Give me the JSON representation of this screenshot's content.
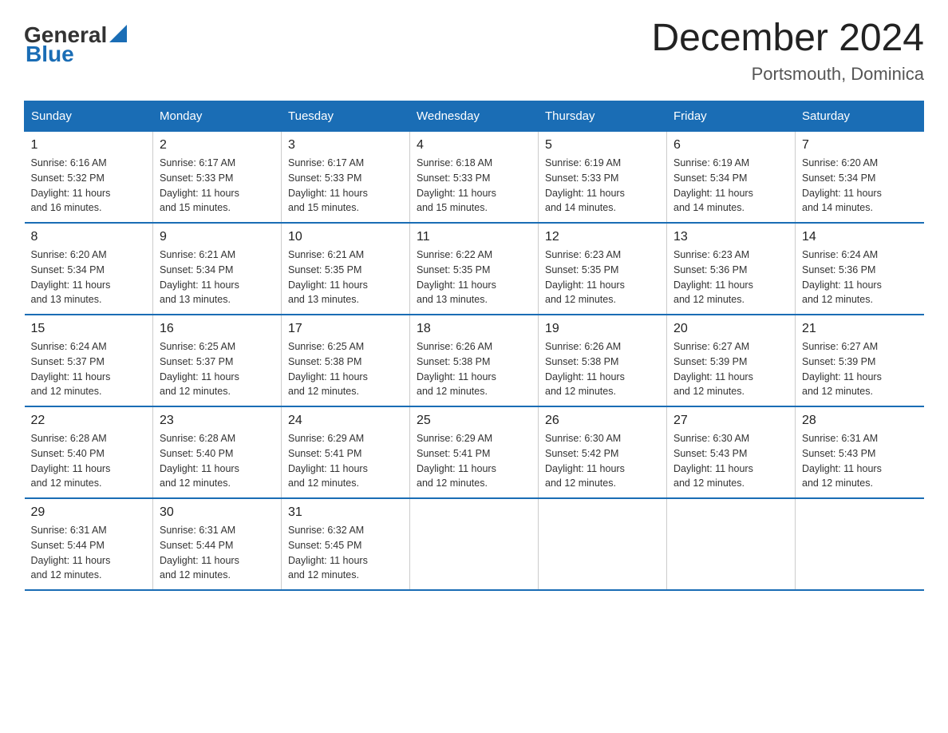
{
  "header": {
    "logo": {
      "general": "General",
      "blue": "Blue"
    },
    "title": "December 2024",
    "location": "Portsmouth, Dominica"
  },
  "calendar": {
    "weekdays": [
      "Sunday",
      "Monday",
      "Tuesday",
      "Wednesday",
      "Thursday",
      "Friday",
      "Saturday"
    ],
    "weeks": [
      [
        {
          "day": "1",
          "info": "Sunrise: 6:16 AM\nSunset: 5:32 PM\nDaylight: 11 hours\nand 16 minutes."
        },
        {
          "day": "2",
          "info": "Sunrise: 6:17 AM\nSunset: 5:33 PM\nDaylight: 11 hours\nand 15 minutes."
        },
        {
          "day": "3",
          "info": "Sunrise: 6:17 AM\nSunset: 5:33 PM\nDaylight: 11 hours\nand 15 minutes."
        },
        {
          "day": "4",
          "info": "Sunrise: 6:18 AM\nSunset: 5:33 PM\nDaylight: 11 hours\nand 15 minutes."
        },
        {
          "day": "5",
          "info": "Sunrise: 6:19 AM\nSunset: 5:33 PM\nDaylight: 11 hours\nand 14 minutes."
        },
        {
          "day": "6",
          "info": "Sunrise: 6:19 AM\nSunset: 5:34 PM\nDaylight: 11 hours\nand 14 minutes."
        },
        {
          "day": "7",
          "info": "Sunrise: 6:20 AM\nSunset: 5:34 PM\nDaylight: 11 hours\nand 14 minutes."
        }
      ],
      [
        {
          "day": "8",
          "info": "Sunrise: 6:20 AM\nSunset: 5:34 PM\nDaylight: 11 hours\nand 13 minutes."
        },
        {
          "day": "9",
          "info": "Sunrise: 6:21 AM\nSunset: 5:34 PM\nDaylight: 11 hours\nand 13 minutes."
        },
        {
          "day": "10",
          "info": "Sunrise: 6:21 AM\nSunset: 5:35 PM\nDaylight: 11 hours\nand 13 minutes."
        },
        {
          "day": "11",
          "info": "Sunrise: 6:22 AM\nSunset: 5:35 PM\nDaylight: 11 hours\nand 13 minutes."
        },
        {
          "day": "12",
          "info": "Sunrise: 6:23 AM\nSunset: 5:35 PM\nDaylight: 11 hours\nand 12 minutes."
        },
        {
          "day": "13",
          "info": "Sunrise: 6:23 AM\nSunset: 5:36 PM\nDaylight: 11 hours\nand 12 minutes."
        },
        {
          "day": "14",
          "info": "Sunrise: 6:24 AM\nSunset: 5:36 PM\nDaylight: 11 hours\nand 12 minutes."
        }
      ],
      [
        {
          "day": "15",
          "info": "Sunrise: 6:24 AM\nSunset: 5:37 PM\nDaylight: 11 hours\nand 12 minutes."
        },
        {
          "day": "16",
          "info": "Sunrise: 6:25 AM\nSunset: 5:37 PM\nDaylight: 11 hours\nand 12 minutes."
        },
        {
          "day": "17",
          "info": "Sunrise: 6:25 AM\nSunset: 5:38 PM\nDaylight: 11 hours\nand 12 minutes."
        },
        {
          "day": "18",
          "info": "Sunrise: 6:26 AM\nSunset: 5:38 PM\nDaylight: 11 hours\nand 12 minutes."
        },
        {
          "day": "19",
          "info": "Sunrise: 6:26 AM\nSunset: 5:38 PM\nDaylight: 11 hours\nand 12 minutes."
        },
        {
          "day": "20",
          "info": "Sunrise: 6:27 AM\nSunset: 5:39 PM\nDaylight: 11 hours\nand 12 minutes."
        },
        {
          "day": "21",
          "info": "Sunrise: 6:27 AM\nSunset: 5:39 PM\nDaylight: 11 hours\nand 12 minutes."
        }
      ],
      [
        {
          "day": "22",
          "info": "Sunrise: 6:28 AM\nSunset: 5:40 PM\nDaylight: 11 hours\nand 12 minutes."
        },
        {
          "day": "23",
          "info": "Sunrise: 6:28 AM\nSunset: 5:40 PM\nDaylight: 11 hours\nand 12 minutes."
        },
        {
          "day": "24",
          "info": "Sunrise: 6:29 AM\nSunset: 5:41 PM\nDaylight: 11 hours\nand 12 minutes."
        },
        {
          "day": "25",
          "info": "Sunrise: 6:29 AM\nSunset: 5:41 PM\nDaylight: 11 hours\nand 12 minutes."
        },
        {
          "day": "26",
          "info": "Sunrise: 6:30 AM\nSunset: 5:42 PM\nDaylight: 11 hours\nand 12 minutes."
        },
        {
          "day": "27",
          "info": "Sunrise: 6:30 AM\nSunset: 5:43 PM\nDaylight: 11 hours\nand 12 minutes."
        },
        {
          "day": "28",
          "info": "Sunrise: 6:31 AM\nSunset: 5:43 PM\nDaylight: 11 hours\nand 12 minutes."
        }
      ],
      [
        {
          "day": "29",
          "info": "Sunrise: 6:31 AM\nSunset: 5:44 PM\nDaylight: 11 hours\nand 12 minutes."
        },
        {
          "day": "30",
          "info": "Sunrise: 6:31 AM\nSunset: 5:44 PM\nDaylight: 11 hours\nand 12 minutes."
        },
        {
          "day": "31",
          "info": "Sunrise: 6:32 AM\nSunset: 5:45 PM\nDaylight: 11 hours\nand 12 minutes."
        },
        null,
        null,
        null,
        null
      ]
    ]
  }
}
